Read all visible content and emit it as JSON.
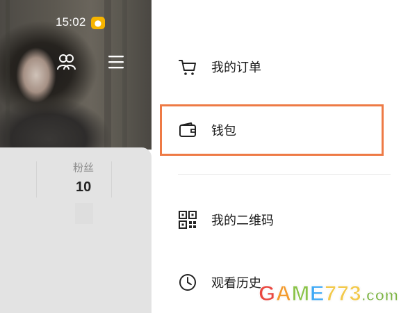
{
  "status_bar": {
    "time": "15:02",
    "app_badge_icon": "weibo-icon"
  },
  "profile": {
    "header_icons": [
      "people-icon",
      "menu-icon"
    ],
    "fans_label": "粉丝",
    "fans_count": "10"
  },
  "menu": {
    "items": [
      {
        "label": "我的订单",
        "icon": "cart-icon"
      },
      {
        "label": "钱包",
        "icon": "wallet-icon",
        "highlighted": true
      },
      {
        "label": "我的二维码",
        "icon": "qr-code-icon"
      },
      {
        "label": "观看历史",
        "icon": "clock-icon"
      }
    ],
    "highlight_color": "#ee7a45"
  },
  "watermark": {
    "parts": [
      "G",
      "A",
      "M",
      "E",
      "773",
      ".com"
    ]
  }
}
